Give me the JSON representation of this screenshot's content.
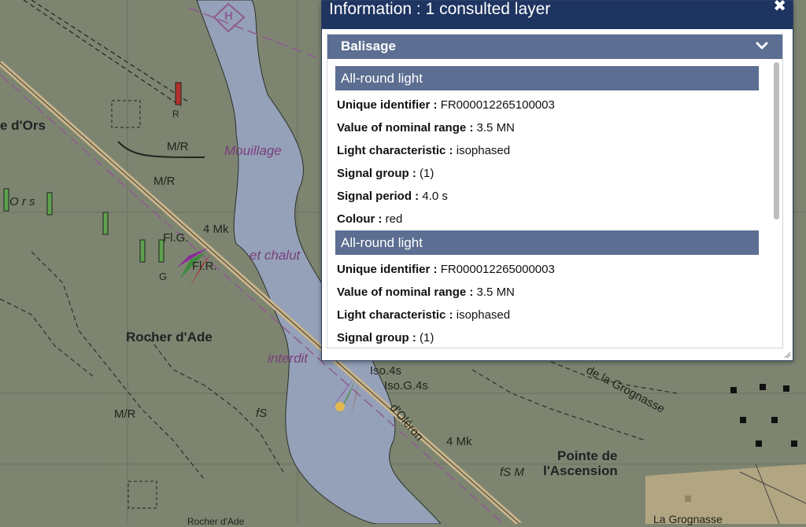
{
  "popup": {
    "title": "Information : 1 consulted layer",
    "close_icon": "✖",
    "section": {
      "title": "Balisage",
      "features": [
        {
          "title": "All-round light",
          "attributes": [
            {
              "key": "Unique identifier",
              "value": "FR000012265100003"
            },
            {
              "key": "Value of nominal range",
              "value": "3.5 MN"
            },
            {
              "key": "Light characteristic",
              "value": "isophased"
            },
            {
              "key": "Signal group",
              "value": "(1)"
            },
            {
              "key": "Signal period",
              "value": "4.0 s"
            },
            {
              "key": "Colour",
              "value": "red"
            }
          ]
        },
        {
          "title": "All-round light",
          "attributes": [
            {
              "key": "Unique identifier",
              "value": "FR000012265000003"
            },
            {
              "key": "Value of nominal range",
              "value": "3.5 MN"
            },
            {
              "key": "Light characteristic",
              "value": "isophased"
            },
            {
              "key": "Signal group",
              "value": "(1)"
            }
          ]
        }
      ]
    }
  },
  "map": {
    "labels": {
      "ors": "e d'Ors",
      "mouillage": "Mouillage",
      "chalut": "et chalut",
      "interdit": "interdit",
      "rocher": "Rocher d'Ade",
      "mr1": "M/R",
      "mr2": "M/R",
      "mr3": "M/R",
      "fig": "Fl.G.",
      "fr": "Fl.R.",
      "mk1": "4 Mk",
      "iso": "Iso.4s",
      "isog": "Iso.G.4s",
      "oleron": "d'Oléron",
      "mk2": "4 Mk",
      "grognasse": "de la Grognasse",
      "pointe": "Pointe de",
      "ascension": "l'Ascension",
      "fsm": "fS M",
      "fs": "fS",
      "g": "G",
      "r": "R",
      "h": "H",
      "ors2": "O r s",
      "lagrognasse": "La Grognasse",
      "rocherade2": "Rocher d'Ade"
    },
    "colors": {
      "land": "#7d8571",
      "water": "#95a1b8",
      "road": "#c9b48a"
    }
  }
}
